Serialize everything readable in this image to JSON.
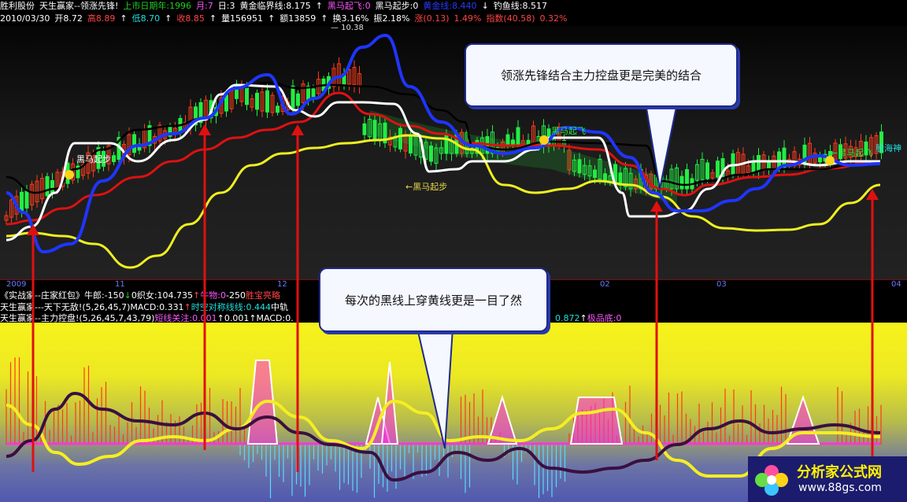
{
  "header": {
    "row1": [
      {
        "text": "胜利股份",
        "color": "#ffffff"
      },
      {
        "text": "天生赢家--领涨先锋!",
        "color": "#ffffff"
      },
      {
        "text": "上市日期年:1996",
        "color": "#22cc22"
      },
      {
        "text": "月:7",
        "color": "#ff55ff"
      },
      {
        "text": "日:3",
        "color": "#ffffff"
      },
      {
        "text": "黄金临界线:8.175",
        "color": "#ffffff"
      },
      {
        "text": "↑",
        "color": "#ffffff"
      },
      {
        "text": "黑马起飞:0",
        "color": "#ff55ff"
      },
      {
        "text": "黑马起步:0",
        "color": "#ffffff"
      },
      {
        "text": "黄金线:8.440",
        "color": "#2a3aff"
      },
      {
        "text": "↓",
        "color": "#ffffff"
      },
      {
        "text": "钓鱼线:8.517",
        "color": "#ffffff"
      }
    ],
    "row2": [
      {
        "text": "2010/03/30",
        "color": "#ffffff"
      },
      {
        "text": "开8.72",
        "color": "#ffffff"
      },
      {
        "text": "高8.89",
        "color": "#ff4444"
      },
      {
        "text": "↑",
        "color": "#ffffff"
      },
      {
        "text": "低8.70",
        "color": "#22dddd"
      },
      {
        "text": "↑",
        "color": "#ffffff"
      },
      {
        "text": "收8.85",
        "color": "#ff4444"
      },
      {
        "text": "↑",
        "color": "#ffffff"
      },
      {
        "text": "量156951",
        "color": "#ffffff"
      },
      {
        "text": "↑",
        "color": "#ffffff"
      },
      {
        "text": "额13859",
        "color": "#ffffff"
      },
      {
        "text": "↑",
        "color": "#ffffff"
      },
      {
        "text": "换3.16%",
        "color": "#ffffff"
      },
      {
        "text": "振2.18%",
        "color": "#ffffff"
      },
      {
        "text": "涨(0.13)",
        "color": "#ff4444"
      },
      {
        "text": "1.49%",
        "color": "#ff4444"
      },
      {
        "text": "指数(40.58)",
        "color": "#ff4444"
      },
      {
        "text": "0.32%",
        "color": "#ff4444"
      }
    ]
  },
  "price_label": "10.38",
  "annotations": {
    "top_bubble": "领涨先锋结合主力控盘更是完美的结合",
    "mid_bubble": "每次的黑线上穿黄线更是一目了然",
    "black_horse_1": "黑马起步",
    "black_horse_2": "←黑马起步",
    "black_horse_3": "黑马起飞",
    "black_horse_4": "←黑马起飞",
    "black_horse_5": "股海神"
  },
  "x_ticks": [
    "2009",
    "11",
    "12",
    "02",
    "03",
    "04"
  ],
  "indicator_rows": {
    "row1": [
      {
        "text": "《实战家--庄家红包》",
        "color": "#ffffff"
      },
      {
        "text": "牛郎:-150",
        "color": "#ffffff"
      },
      {
        "text": "↓",
        "color": "#22cc22"
      },
      {
        "text": "0",
        "color": "#ffffff"
      },
      {
        "text": "织女:104.735",
        "color": "#ffffff"
      },
      {
        "text": "↑",
        "color": "#ff4444"
      },
      {
        "text": "牛物:0",
        "color": "#ff55ff"
      },
      {
        "text": "-250",
        "color": "#ffffff"
      },
      {
        "text": "胜宝亮略",
        "color": "#ff4444"
      }
    ],
    "row2": [
      {
        "text": "天生赢家---天下无敌!(5,26,45,7)",
        "color": "#ffffff"
      },
      {
        "text": "MACD:0.331",
        "color": "#ffffff"
      },
      {
        "text": "↑",
        "color": "#ff4444"
      },
      {
        "text": "时空对称线线:0.444",
        "color": "#22dddd"
      },
      {
        "text": "中轨",
        "color": "#ffffff"
      }
    ],
    "row3": [
      {
        "text": "天生赢家--主力控盘!(5,26,45,7,43,79)",
        "color": "#ffffff"
      },
      {
        "text": "短线关注:0.001",
        "color": "#ff55ff"
      },
      {
        "text": "↑",
        "color": "#ffffff"
      },
      {
        "text": "0.001",
        "color": "#ffffff"
      },
      {
        "text": "↑",
        "color": "#ffffff"
      },
      {
        "text": "MACD:0.",
        "color": "#ffffff"
      }
    ],
    "row3_tail": [
      {
        "text": "0.872",
        "color": "#22dddd"
      },
      {
        "text": "↑",
        "color": "#ffffff"
      },
      {
        "text": "极品底:0",
        "color": "#ff55ff"
      }
    ]
  },
  "logo": {
    "name": "分析家公式网",
    "url": "www.88gs.com"
  },
  "chart_data": [
    {
      "type": "line",
      "title": "胜利股份 天生赢家--领涨先锋!",
      "x": [
        "2009",
        "11",
        "12",
        "02",
        "03",
        "04"
      ],
      "series": [
        {
          "name": "黄金线",
          "color": "#1f35ff",
          "values": [
            7.4,
            6.7,
            7.6,
            8.9,
            8.6,
            10.1,
            8.6,
            8.4,
            8.0,
            7.7,
            8.0,
            8.4
          ]
        },
        {
          "name": "黄金临界线",
          "color": "#ffffff",
          "values": [
            6.9,
            7.9,
            7.9,
            8.6,
            8.7,
            8.7,
            8.1,
            8.2,
            8.3,
            7.6,
            8.1,
            8.2
          ]
        },
        {
          "name": "钓鱼线",
          "color": "#000000",
          "values": [
            7.7,
            7.9,
            8.4,
            8.7,
            8.8,
            8.7,
            8.4,
            8.3,
            8.5,
            7.8,
            8.1,
            8.5
          ]
        },
        {
          "name": "",
          "color": "#dd1111",
          "values": [
            6.9,
            7.5,
            8.1,
            8.4,
            8.6,
            8.8,
            8.6,
            8.4,
            8.0,
            7.7,
            8.0,
            8.4
          ]
        },
        {
          "name": "",
          "color": "#eeee22",
          "values": [
            6.8,
            6.5,
            7.1,
            7.8,
            8.0,
            8.2,
            7.7,
            7.5,
            7.3,
            7.0,
            7.4,
            7.9
          ]
        }
      ]
    },
    {
      "type": "line",
      "title": "天生赢家--主力控盘!(5,26,45,7,43,79)",
      "x": [
        "2009",
        "11",
        "12",
        "02",
        "03",
        "04"
      ],
      "series": [
        {
          "name": "",
          "color": "#3a1040",
          "values": [
            0.0,
            0.5,
            0.2,
            0.1,
            -0.3,
            -0.2,
            -0.4,
            -0.2,
            0.1,
            0.0,
            0.3,
            0.1
          ]
        },
        {
          "name": "",
          "color": "#eeee22",
          "values": [
            0.4,
            -0.4,
            0.3,
            0.6,
            -0.2,
            0.5,
            -0.5,
            0.6,
            -0.3,
            0.2,
            -0.4,
            0.1
          ]
        },
        {
          "name": "短线关注",
          "color": "#ff33dd",
          "values": [
            0,
            0,
            0,
            1,
            0,
            1,
            0,
            0,
            1,
            0,
            0,
            1
          ]
        }
      ]
    }
  ]
}
